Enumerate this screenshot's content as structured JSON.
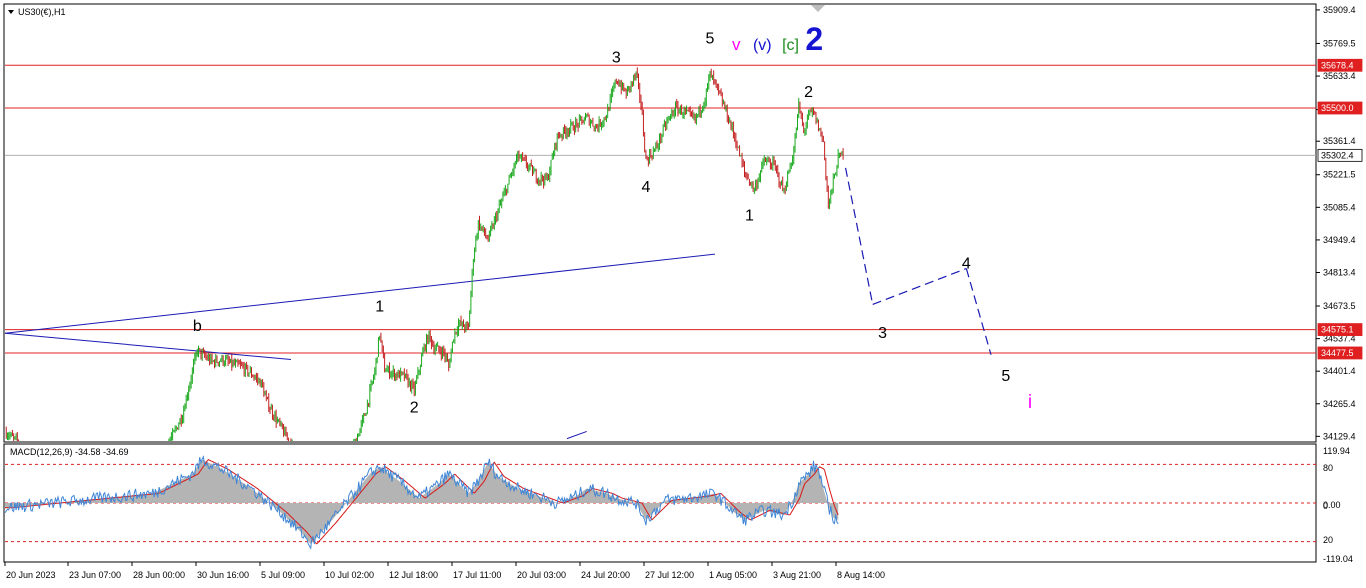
{
  "title": "US30(€),H1",
  "colors": {
    "bull": "#19a81c",
    "bear": "#c31e1e",
    "hline": "#e02020",
    "trend": "#1a1ab4",
    "macd_hist": "#b4b4b4",
    "macd_main": "#3f86d6",
    "macd_signal": "#d81818",
    "magenta": "#ff00ff",
    "wave_blue": "#1414d2",
    "wave_green": "#1e8c1e"
  },
  "price_axis": {
    "ticks": [
      "35909.4",
      "35769.5",
      "35633.4",
      "35493.5",
      "35361.4",
      "35221.5",
      "35085.4",
      "34949.4",
      "34813.4",
      "34673.5",
      "34537.4",
      "34401.4",
      "34265.4",
      "34129.4"
    ],
    "tagged": [
      {
        "label": "35678.4",
        "value": 35678.4,
        "kind": "line"
      },
      {
        "label": "35500.0",
        "value": 35500.0,
        "kind": "line"
      },
      {
        "label": "35302.4",
        "value": 35302.4,
        "kind": "current"
      },
      {
        "label": "34575.1",
        "value": 34575.1,
        "kind": "line"
      },
      {
        "label": "34477.5",
        "value": 34477.5,
        "kind": "line"
      }
    ]
  },
  "macd": {
    "label": "MACD(12,26,9) -34.58 -34.69",
    "ticks": [
      "119.94",
      "80",
      "0.00",
      "0",
      "20",
      "-119.04"
    ]
  },
  "time_axis": [
    "20 Jun 2023",
    "23 Jun 07:00",
    "28 Jun 00:00",
    "30 Jun 16:00",
    "5 Jul 09:00",
    "10 Jul 02:00",
    "12 Jul 18:00",
    "17 Jul 11:00",
    "20 Jul 03:00",
    "24 Jul 20:00",
    "27 Jul 12:00",
    "1 Aug 05:00",
    "3 Aug 21:00",
    "8 Aug 14:00"
  ],
  "wave_labels": [
    {
      "text": "b",
      "price": 34570,
      "bar": 39
    },
    {
      "text": "1",
      "price": 34650,
      "bar": 76
    },
    {
      "text": "2",
      "price": 34230,
      "bar": 83
    },
    {
      "text": "3",
      "price": 35690,
      "bar": 124
    },
    {
      "text": "4",
      "price": 35150,
      "bar": 130
    },
    {
      "text": "5",
      "price": 35770,
      "bar": 143
    },
    {
      "text": "1",
      "price": 35030,
      "bar": 151
    },
    {
      "text": "2",
      "price": 35545,
      "bar": 163
    },
    {
      "text": "3",
      "price": 34540,
      "bar": 178
    },
    {
      "text": "4",
      "price": 34830,
      "bar": 195
    },
    {
      "text": "5",
      "price": 34360,
      "bar": 203
    }
  ],
  "big_label": {
    "parts": [
      {
        "text": "v",
        "color": "magenta"
      },
      {
        "text": "(v)",
        "color": "wave_blue"
      },
      {
        "text": "[c]",
        "color": "wave_green"
      },
      {
        "text": "2",
        "color": "wave_blue"
      }
    ]
  },
  "sub_label": {
    "text": "i",
    "color": "magenta"
  },
  "chart_data": {
    "type": "candlestick",
    "symbol": "US30(€)",
    "timeframe": "H1",
    "ylim": [
      34110,
      35930
    ],
    "horizontal_lines": [
      35678.4,
      35500.0,
      34575.1,
      34477.5
    ],
    "current_price": 35302.4,
    "price_path": [
      [
        0,
        34150
      ],
      [
        4,
        34080
      ],
      [
        8,
        34020
      ],
      [
        12,
        34040
      ],
      [
        16,
        34060
      ],
      [
        20,
        34000
      ],
      [
        24,
        34020
      ],
      [
        28,
        34050
      ],
      [
        32,
        34060
      ],
      [
        34,
        34130
      ],
      [
        36,
        34220
      ],
      [
        38,
        34400
      ],
      [
        39,
        34490
      ],
      [
        40,
        34470
      ],
      [
        42,
        34440
      ],
      [
        44,
        34450
      ],
      [
        46,
        34430
      ],
      [
        48,
        34420
      ],
      [
        50,
        34390
      ],
      [
        52,
        34350
      ],
      [
        53,
        34280
      ],
      [
        55,
        34200
      ],
      [
        57,
        34130
      ],
      [
        59,
        34060
      ],
      [
        61,
        34000
      ],
      [
        63,
        33970
      ],
      [
        65,
        33990
      ],
      [
        67,
        34010
      ],
      [
        69,
        34030
      ],
      [
        71,
        34100
      ],
      [
        73,
        34220
      ],
      [
        74,
        34310
      ],
      [
        75,
        34400
      ],
      [
        76,
        34560
      ],
      [
        77,
        34410
      ],
      [
        79,
        34390
      ],
      [
        81,
        34380
      ],
      [
        83,
        34320
      ],
      [
        85,
        34500
      ],
      [
        86,
        34550
      ],
      [
        87,
        34500
      ],
      [
        89,
        34480
      ],
      [
        90,
        34420
      ],
      [
        91,
        34550
      ],
      [
        92,
        34600
      ],
      [
        94,
        34580
      ],
      [
        95,
        34880
      ],
      [
        96,
        35020
      ],
      [
        98,
        34950
      ],
      [
        100,
        35070
      ],
      [
        102,
        35180
      ],
      [
        104,
        35300
      ],
      [
        106,
        35260
      ],
      [
        108,
        35210
      ],
      [
        110,
        35200
      ],
      [
        112,
        35380
      ],
      [
        114,
        35410
      ],
      [
        116,
        35430
      ],
      [
        118,
        35460
      ],
      [
        120,
        35420
      ],
      [
        122,
        35470
      ],
      [
        124,
        35620
      ],
      [
        126,
        35560
      ],
      [
        128,
        35640
      ],
      [
        129,
        35520
      ],
      [
        130,
        35280
      ],
      [
        132,
        35330
      ],
      [
        134,
        35430
      ],
      [
        136,
        35500
      ],
      [
        138,
        35480
      ],
      [
        140,
        35450
      ],
      [
        142,
        35540
      ],
      [
        143,
        35640
      ],
      [
        144,
        35600
      ],
      [
        146,
        35500
      ],
      [
        148,
        35380
      ],
      [
        150,
        35230
      ],
      [
        152,
        35160
      ],
      [
        154,
        35280
      ],
      [
        156,
        35260
      ],
      [
        158,
        35150
      ],
      [
        160,
        35320
      ],
      [
        161,
        35510
      ],
      [
        162,
        35400
      ],
      [
        163,
        35470
      ],
      [
        164,
        35480
      ],
      [
        166,
        35360
      ],
      [
        167,
        35090
      ],
      [
        168,
        35190
      ],
      [
        169,
        35290
      ],
      [
        170,
        35310
      ]
    ],
    "macd_path": [
      [
        0,
        -10
      ],
      [
        10,
        0
      ],
      [
        20,
        10
      ],
      [
        30,
        20
      ],
      [
        38,
        60
      ],
      [
        40,
        90
      ],
      [
        44,
        70
      ],
      [
        50,
        30
      ],
      [
        56,
        -20
      ],
      [
        60,
        -60
      ],
      [
        62,
        -85
      ],
      [
        66,
        -40
      ],
      [
        70,
        10
      ],
      [
        74,
        60
      ],
      [
        76,
        75
      ],
      [
        80,
        45
      ],
      [
        84,
        10
      ],
      [
        88,
        40
      ],
      [
        90,
        60
      ],
      [
        94,
        20
      ],
      [
        96,
        45
      ],
      [
        98,
        85
      ],
      [
        100,
        55
      ],
      [
        104,
        30
      ],
      [
        108,
        15
      ],
      [
        112,
        0
      ],
      [
        116,
        15
      ],
      [
        118,
        30
      ],
      [
        122,
        20
      ],
      [
        124,
        10
      ],
      [
        128,
        0
      ],
      [
        130,
        -35
      ],
      [
        134,
        5
      ],
      [
        138,
        10
      ],
      [
        142,
        15
      ],
      [
        144,
        20
      ],
      [
        146,
        0
      ],
      [
        148,
        -20
      ],
      [
        150,
        -35
      ],
      [
        154,
        -15
      ],
      [
        158,
        -25
      ],
      [
        160,
        10
      ],
      [
        161,
        40
      ],
      [
        163,
        60
      ],
      [
        164,
        75
      ],
      [
        165,
        70
      ],
      [
        166,
        30
      ],
      [
        167,
        -5
      ],
      [
        168,
        -30
      ],
      [
        169,
        -34.58
      ]
    ],
    "macd_hlevels": [
      80,
      0,
      -80
    ],
    "projection": [
      [
        170.5,
        35250
      ],
      [
        176,
        34680
      ],
      [
        195,
        34830
      ],
      [
        200,
        34470
      ]
    ],
    "trendlines": [
      [
        [
          0,
          34560
        ],
        [
          144,
          34890
        ]
      ],
      [
        [
          0,
          34560
        ],
        [
          58,
          34450
        ]
      ],
      [
        [
          114,
          34120
        ],
        [
          118,
          34150
        ]
      ]
    ]
  }
}
